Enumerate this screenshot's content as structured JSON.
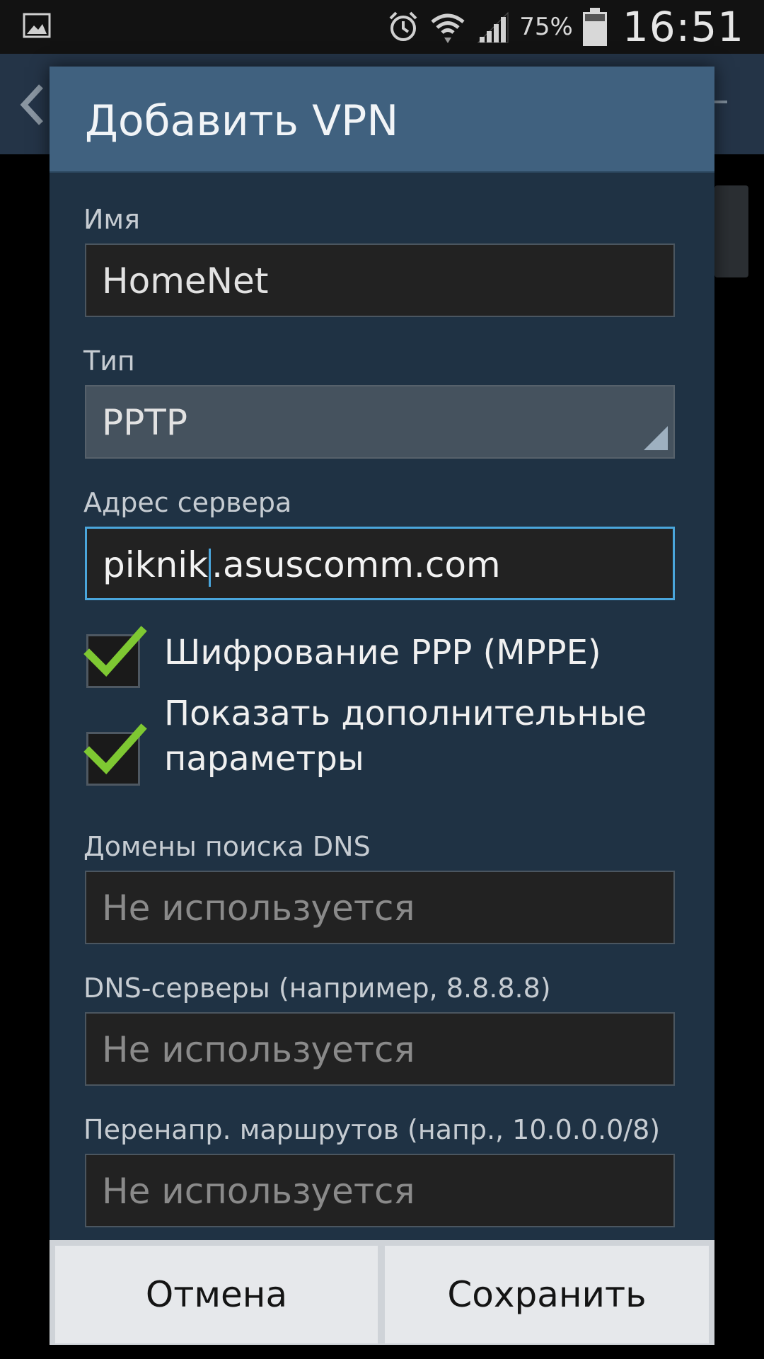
{
  "status_bar": {
    "battery_percent": "75%",
    "time": "16:51"
  },
  "dialog": {
    "title": "Добавить VPN",
    "fields": [
      {
        "label": "Имя",
        "value": "HomeNet"
      },
      {
        "label": "Тип",
        "value": "PPTP"
      },
      {
        "label": "Адрес сервера",
        "value_before_cursor": "piknik",
        "value_after_cursor": ".asuscomm.com"
      },
      {
        "label": "Домены поиска DNS",
        "placeholder": "Не используется"
      },
      {
        "label": "DNS-серверы (например, 8.8.8.8)",
        "placeholder": "Не используется"
      },
      {
        "label": "Перенапр. маршрутов (напр., 10.0.0.0/8)",
        "placeholder": "Не используется"
      }
    ],
    "checkboxes": [
      {
        "label": "Шифрование PPP (MPPE)",
        "checked": true
      },
      {
        "label": "Показать дополнительные параметры",
        "checked": true
      }
    ],
    "buttons": {
      "cancel": "Отмена",
      "save": "Сохранить"
    }
  },
  "colors": {
    "dialog_header": "#40617f",
    "dialog_body": "#1f3244",
    "focus_accent": "#4aa6dc",
    "checkmark": "#7ec832"
  },
  "icons": [
    "gallery-icon",
    "alarm-icon",
    "wifi-icon",
    "signal-icon",
    "battery-icon",
    "back-icon",
    "checkmark-icon",
    "dropdown-arrow-icon"
  ]
}
